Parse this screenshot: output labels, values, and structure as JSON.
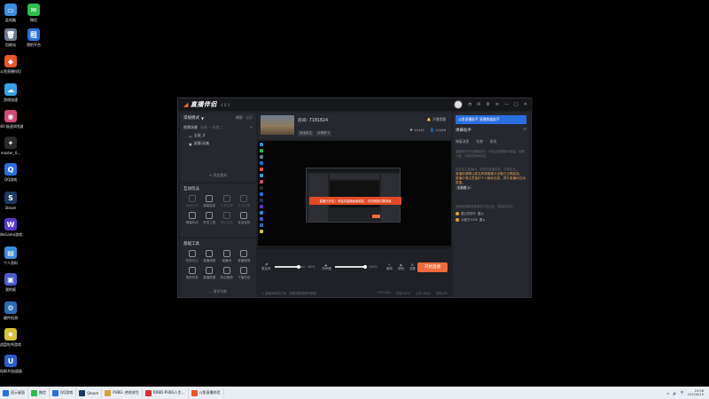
{
  "desktop": {
    "icons": [
      {
        "label": "此电脑",
        "color": "#3a8dde",
        "glyph": "▭"
      },
      {
        "label": "微信",
        "color": "#2bbd4d",
        "glyph": "✉"
      },
      {
        "label": "回收站",
        "color": "#6a7b8c",
        "glyph": "🗑"
      },
      {
        "label": "猎豹平台",
        "color": "#2a6fe0",
        "glyph": "租"
      },
      {
        "label": "斗鱼直播伴侣",
        "color": "#e8562a",
        "glyph": "◆"
      },
      {
        "label": "游戏加速",
        "color": "#3aa0e6",
        "glyph": "☁"
      },
      {
        "label": "360 极速浏览器X",
        "color": "#d04a7a",
        "glyph": "◉"
      },
      {
        "label": "master_0...",
        "color": "#2b2b2b",
        "glyph": "✦"
      },
      {
        "label": "QQ游戏",
        "color": "#2a6fe0",
        "glyph": "Q"
      },
      {
        "label": "Steam",
        "color": "#1b3a5c",
        "glyph": "S"
      },
      {
        "label": "WeGame游戏",
        "color": "#5a3ac8",
        "glyph": "W"
      },
      {
        "label": "个人资料",
        "color": "#3a8dde",
        "glyph": "▤"
      },
      {
        "label": "我的驱",
        "color": "#4a5ccc",
        "glyph": "▣"
      },
      {
        "label": "硬件检测",
        "color": "#2d6bb5",
        "glyph": "⚙"
      },
      {
        "label": "战盘吃鸡游戏",
        "color": "#d6c23a",
        "glyph": "✸"
      },
      {
        "label": "网易UU加速器",
        "color": "#2a5ec8",
        "glyph": "U"
      }
    ]
  },
  "app": {
    "brand": "直播伴侣",
    "version": "4.8.0",
    "left": {
      "scene_title": "常规模式",
      "scene_edit": "横屏",
      "scene_sub": "竖屏",
      "sources_title": "视频场景",
      "sources_sub": "场景一  场景二",
      "sources": [
        "全屏_4",
        "屏幕/采集"
      ],
      "add_source": "+ 添加素材",
      "interact_title": "互动玩法",
      "interact_tools": [
        {
          "label": "弹幕互动",
          "dim": true
        },
        {
          "label": "弹幕抽奖",
          "dim": false
        },
        {
          "label": "礼物投票",
          "dim": true
        },
        {
          "label": "互动答题",
          "dim": true
        },
        {
          "label": "弹幕玩法",
          "dim": false
        },
        {
          "label": "任务工具",
          "dim": false
        },
        {
          "label": "观众连麦",
          "dim": true
        },
        {
          "label": "互动游戏",
          "dim": false
        }
      ],
      "basic_title": "基础工具",
      "basic_tools": [
        {
          "label": "任务中心"
        },
        {
          "label": "直播海报"
        },
        {
          "label": "直播间"
        },
        {
          "label": "直播管理"
        },
        {
          "label": "美颜特效"
        },
        {
          "label": "直播数据"
        },
        {
          "label": "粉丝管理"
        },
        {
          "label": "下播总结"
        }
      ],
      "more": "— 更多功能"
    },
    "room": {
      "id_text": "房间: 7181824",
      "tags": [
        "绝地求生",
        "大神带飞"
      ],
      "right_top": "开播提醒",
      "stat_a": "12445",
      "stat_b": "14446"
    },
    "preview": {
      "toast": "直播已开启！请保持直播画面稳定，切勿频繁切换场景"
    },
    "controls": {
      "mic_label": "麦克风",
      "mic_pct": "82%",
      "mic_level": 0.82,
      "speaker_label": "扬声器",
      "speaker_pct": "100%",
      "speaker_level": 1.0,
      "btn_a": "美颜",
      "btn_b": "录制",
      "btn_c": "设置",
      "start_label": "开始直播",
      "status_left": "◎ 直播间状态正常，如需调整请联系客服",
      "status_items": [
        "CPU:18%",
        "内存:45%",
        "上传:0kb/s",
        "丢帧:0%"
      ]
    },
    "right": {
      "banner": "斗鱼直播助手 直播数据助手",
      "title": "弹幕助手",
      "tabs": [
        "弹幕消息",
        "礼物",
        "贵宾"
      ],
      "text_1": "直播间已开启弹幕助手，可在此查看观众弹幕，观看人数，礼物动态等信息。",
      "text_2": "欢迎进入直播间，请遵守直播规范，文明发言。",
      "orange_1": "直播前请确认麦克风和摄像头设备已正确连接。",
      "orange_2": "直播中请注意保护个人隐私信息，提升直播间互动氛围。",
      "chip": "去看看 >",
      "text_3": "直播间弹幕消息将显示在此处，请保持关注。",
      "users": [
        {
          "name": "路过的观众",
          "badge": "进入"
        },
        {
          "name": "大魔王2008",
          "badge": "进入"
        }
      ]
    }
  },
  "taskbar": {
    "items": [
      {
        "label": "显示桌面",
        "color": "#2a6fe0"
      },
      {
        "label": "微信",
        "color": "#2bbd4d"
      },
      {
        "label": "QQ游戏",
        "color": "#2a6fe0"
      },
      {
        "label": "Steam",
        "color": "#1b3a5c"
      },
      {
        "label": "PUBG: 绝地求生",
        "color": "#d6a23a"
      },
      {
        "label": "KRBD-PUBG人生...",
        "color": "#c33"
      },
      {
        "label": "斗鱼直播伴侣",
        "color": "#e8562a"
      }
    ],
    "tray": "中",
    "time": "23:58",
    "date": "2025/6/10"
  }
}
